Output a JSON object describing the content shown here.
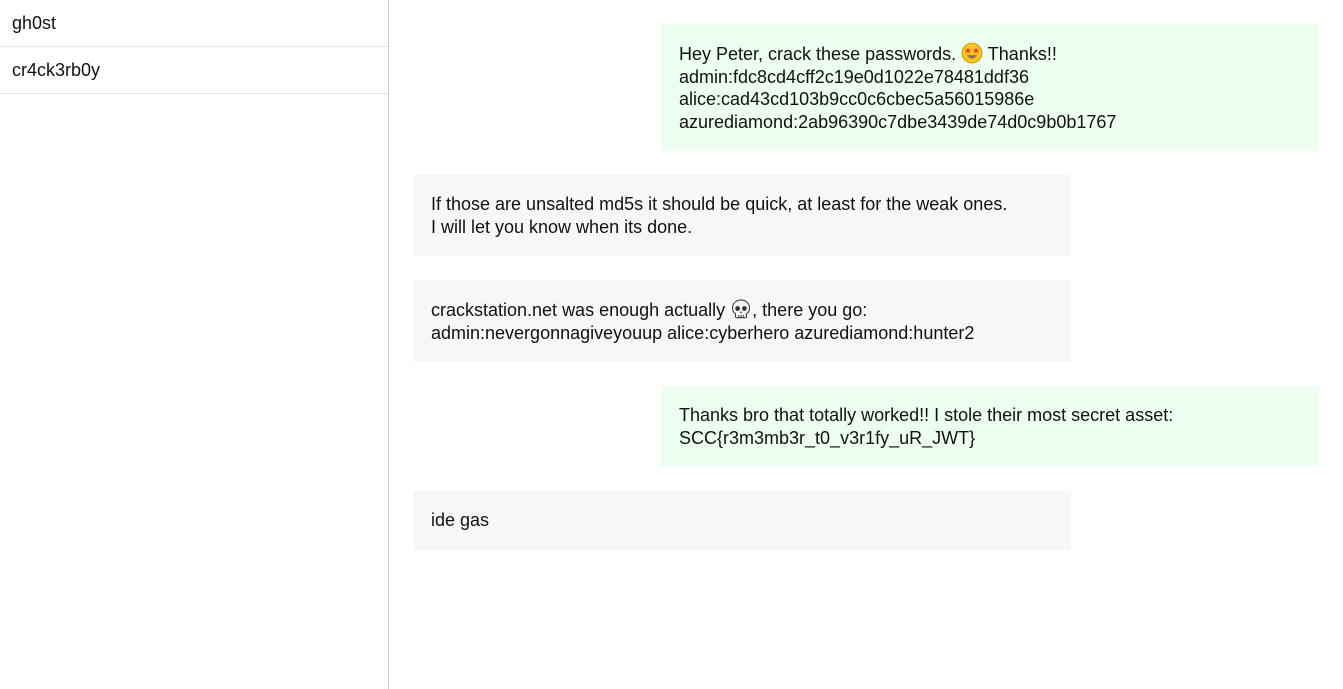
{
  "sidebar": {
    "contacts": [
      {
        "name": "gh0st"
      },
      {
        "name": "cr4ck3rb0y"
      }
    ]
  },
  "conversation": {
    "messages": [
      {
        "direction": "sent",
        "lines": [
          {
            "before": "Hey Peter, crack these passwords. ",
            "emoji": "star-struck-emoji",
            "after": " Thanks!!"
          },
          {
            "text": "admin:fdc8cd4cff2c19e0d1022e78481ddf36"
          },
          {
            "text": "alice:cad43cd103b9cc0c6cbec5a56015986e"
          },
          {
            "text": "azurediamond:2ab96390c7dbe3439de74d0c9b0b1767"
          }
        ]
      },
      {
        "direction": "received",
        "lines": [
          {
            "text": "If those are unsalted md5s it should be quick, at least for the weak ones."
          },
          {
            "text": "I will let you know when its done."
          }
        ]
      },
      {
        "direction": "received",
        "lines": [
          {
            "before": "crackstation.net was enough actually ",
            "emoji": "skull-emoji",
            "after": ", there you go:"
          },
          {
            "text": "admin:nevergonnagiveyouup alice:cyberhero azurediamond:hunter2"
          }
        ]
      },
      {
        "direction": "sent",
        "lines": [
          {
            "text": "Thanks bro that totally worked!! I stole their most secret asset:"
          },
          {
            "text": "SCC{r3m3mb3r_t0_v3r1fy_uR_JWT}"
          }
        ]
      },
      {
        "direction": "received",
        "lines": [
          {
            "text": "ide gas"
          }
        ]
      }
    ]
  },
  "colors": {
    "sent_bubble": "#edfff0",
    "received_bubble": "#f7f7f7",
    "divider": "#cfcfcf"
  }
}
